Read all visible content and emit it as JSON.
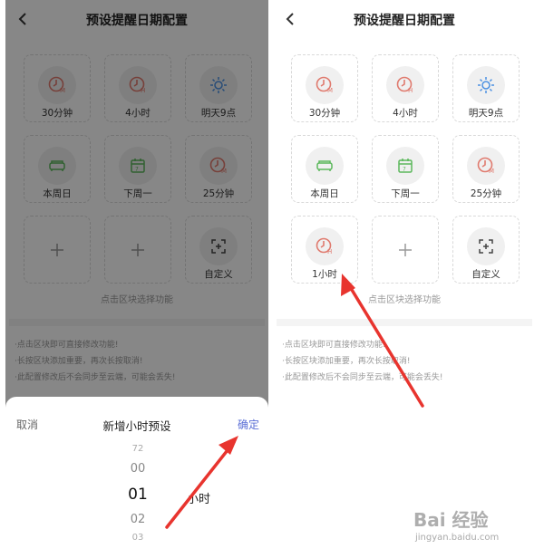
{
  "screens": {
    "left": {
      "title": "预设提醒日期配置",
      "cells": [
        {
          "label": "30分钟",
          "icon": "clock-m-icon",
          "color": "#e07a6e"
        },
        {
          "label": "4小时",
          "icon": "clock-h-icon",
          "color": "#e07a6e"
        },
        {
          "label": "明天9点",
          "icon": "sun-icon",
          "color": "#4a90e2"
        },
        {
          "label": "本周日",
          "icon": "sofa-icon",
          "color": "#5cb85c"
        },
        {
          "label": "下周一",
          "icon": "calendar-icon",
          "color": "#5cb85c"
        },
        {
          "label": "25分钟",
          "icon": "clock-m-icon",
          "color": "#e07a6e"
        },
        {
          "label": "",
          "icon": "plus-icon"
        },
        {
          "label": "",
          "icon": "plus-icon"
        },
        {
          "label": "自定义",
          "icon": "custom-frame-icon",
          "color": "#444444"
        }
      ],
      "hint": "点击区块选择功能",
      "notes": [
        "·点击区块即可直接修改功能!",
        "·长按区块添加重要，再次长按取消!",
        "·此配置修改后不会同步至云端，可能会丢失!"
      ],
      "sheet": {
        "cancel": "取消",
        "title": "新增小时预设",
        "confirm": "确定",
        "picker": [
          "72",
          "00",
          "01",
          "02",
          "03"
        ],
        "selected": "01",
        "unit": "小时"
      }
    },
    "right": {
      "title": "预设提醒日期配置",
      "cells": [
        {
          "label": "30分钟",
          "icon": "clock-m-icon",
          "color": "#e07a6e"
        },
        {
          "label": "4小时",
          "icon": "clock-h-icon",
          "color": "#e07a6e"
        },
        {
          "label": "明天9点",
          "icon": "sun-icon",
          "color": "#4a90e2"
        },
        {
          "label": "本周日",
          "icon": "sofa-icon",
          "color": "#5cb85c"
        },
        {
          "label": "下周一",
          "icon": "calendar-icon",
          "color": "#5cb85c"
        },
        {
          "label": "25分钟",
          "icon": "clock-m-icon",
          "color": "#e07a6e"
        },
        {
          "label": "1小时",
          "icon": "clock-h-icon",
          "color": "#e07a6e"
        },
        {
          "label": "",
          "icon": "plus-icon"
        },
        {
          "label": "自定义",
          "icon": "custom-frame-icon",
          "color": "#444444"
        }
      ],
      "hint": "点击区块选择功能",
      "notes": [
        "·点击区块即可直接修改功能!",
        "·长按区块添加重要，再次长按取消!",
        "·此配置修改后不会同步至云端，可能会丢失!"
      ]
    }
  },
  "watermark": {
    "logo": "Bai 经验",
    "url": "jingyan.baidu.com"
  },
  "colors": {
    "accent": "#5b6fd6",
    "arrow": "#e8342e"
  }
}
